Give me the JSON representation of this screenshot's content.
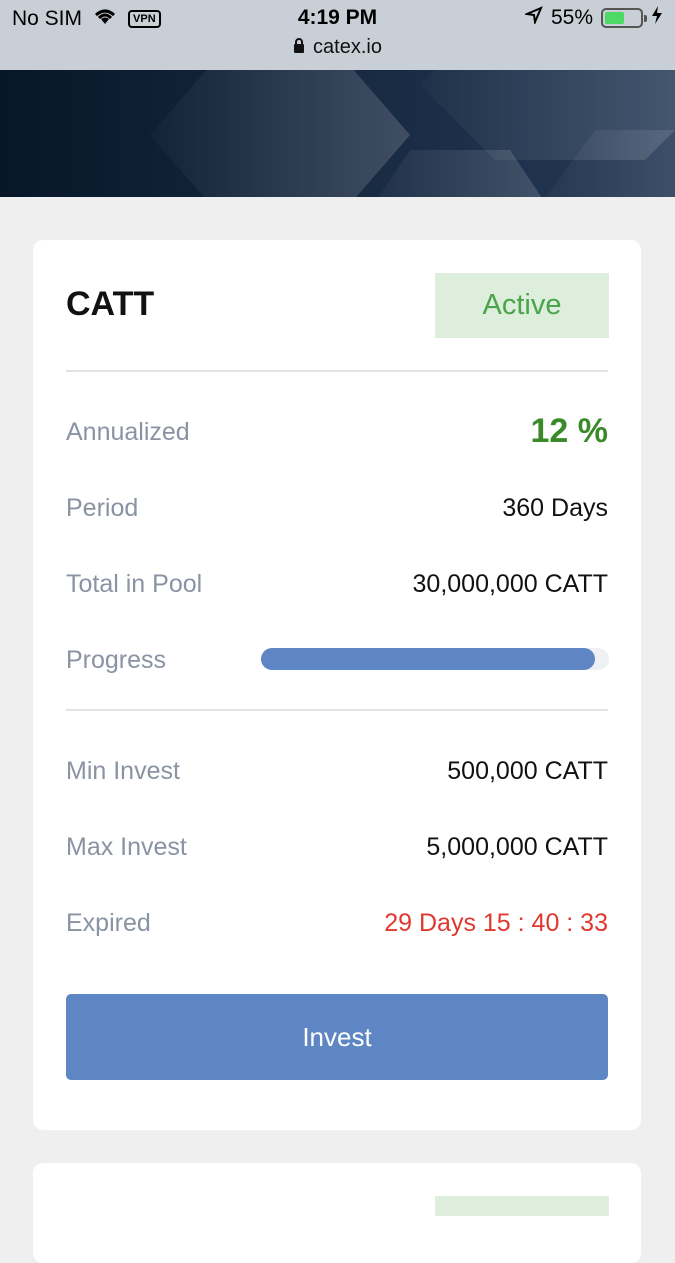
{
  "status_bar": {
    "carrier": "No SIM",
    "vpn": "VPN",
    "time": "4:19 PM",
    "battery_percent": "55%",
    "battery_level": 0.55,
    "url": "catex.io"
  },
  "pool": {
    "title": "CATT",
    "status": "Active",
    "annualized_label": "Annualized",
    "annualized_value": "12 %",
    "period_label": "Period",
    "period_value": "360 Days",
    "total_label": "Total in Pool",
    "total_value": "30,000,000 CATT",
    "progress_label": "Progress",
    "progress": 0.96,
    "min_label": "Min Invest",
    "min_value": "500,000 CATT",
    "max_label": "Max Invest",
    "max_value": "5,000,000 CATT",
    "expired_label": "Expired",
    "expired_value": "29 Days 15 : 40 : 33",
    "invest_label": "Invest"
  },
  "colors": {
    "accent": "#5f86c4",
    "active_green": "#4aa44a",
    "annual_green": "#3a8a2a",
    "countdown_red": "#e0382f"
  }
}
